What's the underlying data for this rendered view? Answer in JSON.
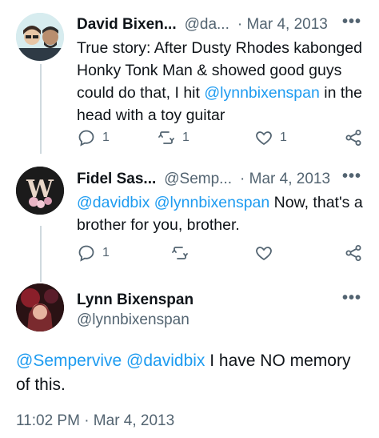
{
  "tweets": [
    {
      "name": "David Bixen...",
      "handle": "@da...",
      "date": "· Mar 4, 2013",
      "more": "•••",
      "text_parts": {
        "t1": "True story: After Dusty Rhodes kabonged Honky Tonk Man & showed good guys could do that, I hit ",
        "m1": "@lynnbixenspan",
        "t2": " in the head with a toy guitar"
      },
      "replies": "1",
      "retweets": "1",
      "likes": "1"
    },
    {
      "name": "Fidel Sas...",
      "handle": "@Semp...",
      "date": "· Mar 4, 2013",
      "more": "•••",
      "text_parts": {
        "m1": "@davidbix",
        "m2": "@lynnbixenspan",
        "t1": " Now, that's a brother for you, brother."
      },
      "replies": "1"
    }
  ],
  "main_tweet": {
    "name": "Lynn Bixenspan",
    "handle": "@lynnbixenspan",
    "more": "•••",
    "text_parts": {
      "m1": "@Sempervive",
      "m2": "@davidbix",
      "t1": " I have NO memory of this."
    },
    "timestamp": "11:02 PM · Mar 4, 2013"
  },
  "colors": {
    "accent": "#1d9bf0",
    "muted": "#536471",
    "line": "#cfd9de"
  },
  "icons": [
    "reply-icon",
    "retweet-icon",
    "like-icon",
    "share-icon",
    "more-icon"
  ]
}
